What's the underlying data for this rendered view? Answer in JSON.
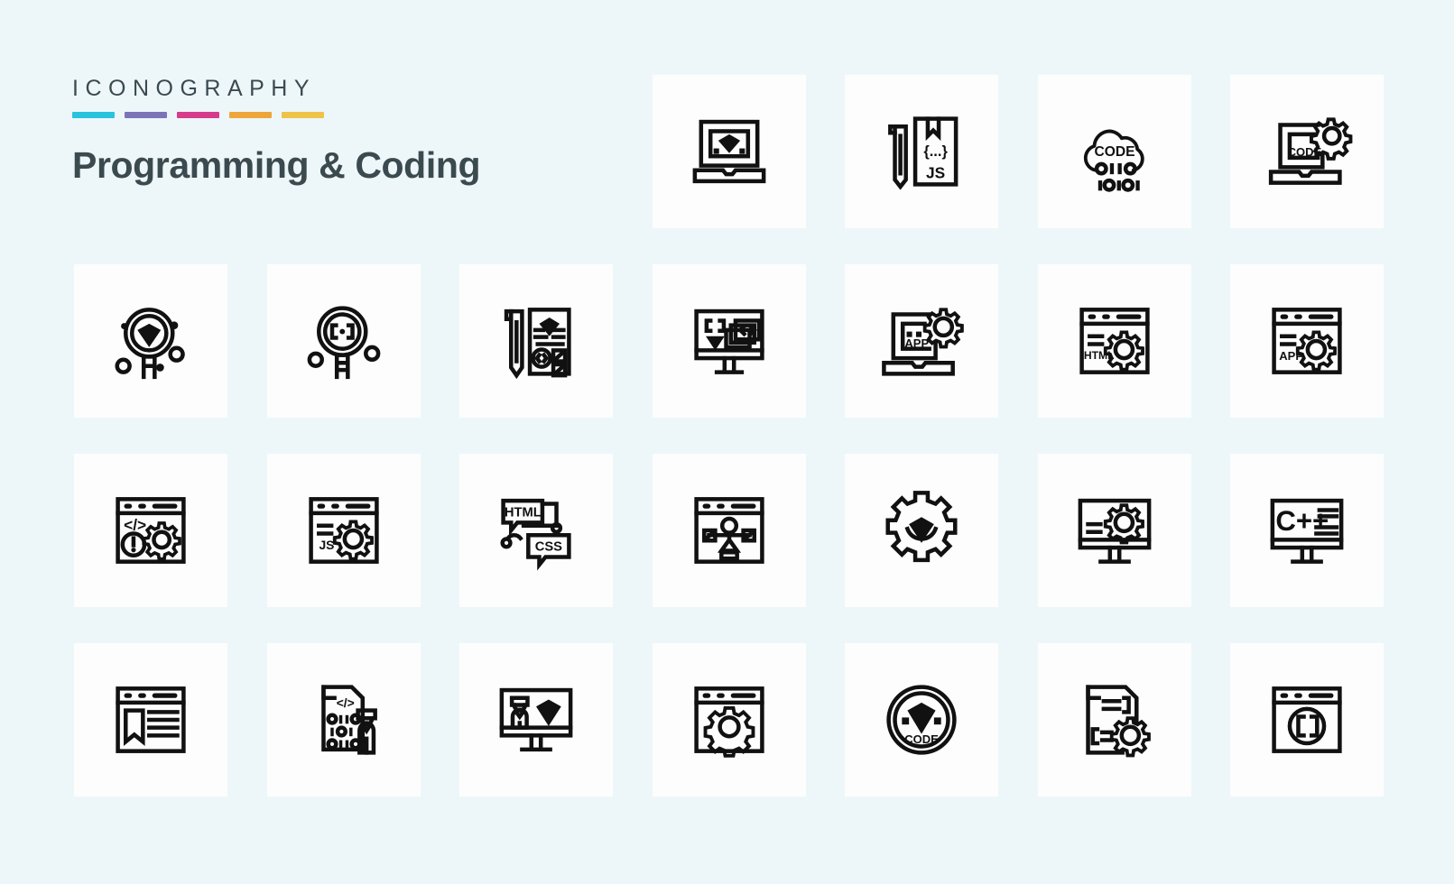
{
  "header": {
    "eyebrow": "ICONOGRAPHY",
    "title": "Programming & Coding",
    "swatches": [
      {
        "name": "cyan",
        "color": "#28c3dd"
      },
      {
        "name": "purple",
        "color": "#7b74b8"
      },
      {
        "name": "magenta",
        "color": "#d63b8c"
      },
      {
        "name": "orange",
        "color": "#eea539"
      },
      {
        "name": "yellow",
        "color": "#efc348"
      }
    ],
    "text_color": "#3b4a4f"
  },
  "theme": {
    "background": "#edf7fa",
    "tile_background": "#fdfdfd",
    "icon_stroke": "#111111"
  },
  "grid": {
    "columns": 7,
    "rows": 4,
    "icons": [
      {
        "row": 1,
        "col": 1,
        "name": "empty-slot",
        "label": "",
        "glyph_texts": []
      },
      {
        "row": 1,
        "col": 2,
        "name": "empty-slot",
        "label": "",
        "glyph_texts": []
      },
      {
        "row": 1,
        "col": 3,
        "name": "empty-slot",
        "label": "",
        "glyph_texts": []
      },
      {
        "row": 1,
        "col": 4,
        "name": "laptop-diamond-icon",
        "label": "Laptop with diamond",
        "glyph_texts": []
      },
      {
        "row": 1,
        "col": 5,
        "name": "pen-js-document-icon",
        "label": "Pen and JS document",
        "glyph_texts": [
          "{...}",
          "JS"
        ]
      },
      {
        "row": 1,
        "col": 6,
        "name": "cloud-code-binary-icon",
        "label": "Cloud code binary",
        "glyph_texts": [
          "CODE",
          "0110",
          "10101"
        ]
      },
      {
        "row": 1,
        "col": 7,
        "name": "laptop-code-gear-icon",
        "label": "Laptop code settings",
        "glyph_texts": [
          "CODE"
        ]
      },
      {
        "row": 2,
        "col": 1,
        "name": "magnifier-diamond-icon",
        "label": "Search diamond",
        "glyph_texts": []
      },
      {
        "row": 2,
        "col": 2,
        "name": "magnifier-code-icon",
        "label": "Search code brackets",
        "glyph_texts": [
          "{..}"
        ]
      },
      {
        "row": 2,
        "col": 3,
        "name": "pencil-design-document-icon",
        "label": "Pencil design document",
        "glyph_texts": []
      },
      {
        "row": 2,
        "col": 4,
        "name": "monitor-code-layers-icon",
        "label": "Monitor code layers",
        "glyph_texts": [
          "{ }",
          "< >"
        ]
      },
      {
        "row": 2,
        "col": 5,
        "name": "laptop-app-gear-icon",
        "label": "Laptop app settings",
        "glyph_texts": [
          "APP"
        ]
      },
      {
        "row": 2,
        "col": 6,
        "name": "browser-html-gear-icon",
        "label": "Browser HTML settings",
        "glyph_texts": [
          "HTML"
        ]
      },
      {
        "row": 2,
        "col": 7,
        "name": "browser-app-gear-icon",
        "label": "Browser app settings",
        "glyph_texts": [
          "APP"
        ]
      },
      {
        "row": 3,
        "col": 1,
        "name": "browser-code-error-gear-icon",
        "label": "Browser code error settings",
        "glyph_texts": [
          "</>",
          "!"
        ]
      },
      {
        "row": 3,
        "col": 2,
        "name": "browser-js-gear-icon",
        "label": "Browser JS settings",
        "glyph_texts": [
          "JS"
        ]
      },
      {
        "row": 3,
        "col": 3,
        "name": "html-css-chat-icon",
        "label": "HTML and CSS chat bubbles",
        "glyph_texts": [
          "HTML",
          "CSS"
        ]
      },
      {
        "row": 3,
        "col": 4,
        "name": "browser-sitemap-icon",
        "label": "Browser sitemap",
        "glyph_texts": []
      },
      {
        "row": 3,
        "col": 5,
        "name": "gear-diamond-icon",
        "label": "Gear with diamond",
        "glyph_texts": []
      },
      {
        "row": 3,
        "col": 6,
        "name": "monitor-gear-icon",
        "label": "Monitor settings",
        "glyph_texts": []
      },
      {
        "row": 3,
        "col": 7,
        "name": "monitor-cpp-icon",
        "label": "Monitor C++ code",
        "glyph_texts": [
          "C++"
        ]
      },
      {
        "row": 4,
        "col": 1,
        "name": "browser-bookmark-icon",
        "label": "Browser bookmark article",
        "glyph_texts": []
      },
      {
        "row": 4,
        "col": 2,
        "name": "code-file-developer-icon",
        "label": "Code file with developer",
        "glyph_texts": [
          "</>",
          "0110",
          "101",
          "0110"
        ]
      },
      {
        "row": 4,
        "col": 3,
        "name": "monitor-developer-diamond-icon",
        "label": "Monitor developer diamond",
        "glyph_texts": []
      },
      {
        "row": 4,
        "col": 4,
        "name": "browser-gear-icon",
        "label": "Browser settings",
        "glyph_texts": []
      },
      {
        "row": 4,
        "col": 5,
        "name": "badge-diamond-code-icon",
        "label": "Code diamond badge",
        "glyph_texts": [
          "CODE"
        ]
      },
      {
        "row": 4,
        "col": 6,
        "name": "code-file-gear-icon",
        "label": "Code file settings",
        "glyph_texts": []
      },
      {
        "row": 4,
        "col": 7,
        "name": "browser-brackets-icon",
        "label": "Browser square brackets",
        "glyph_texts": [
          "[ ]"
        ]
      }
    ]
  }
}
